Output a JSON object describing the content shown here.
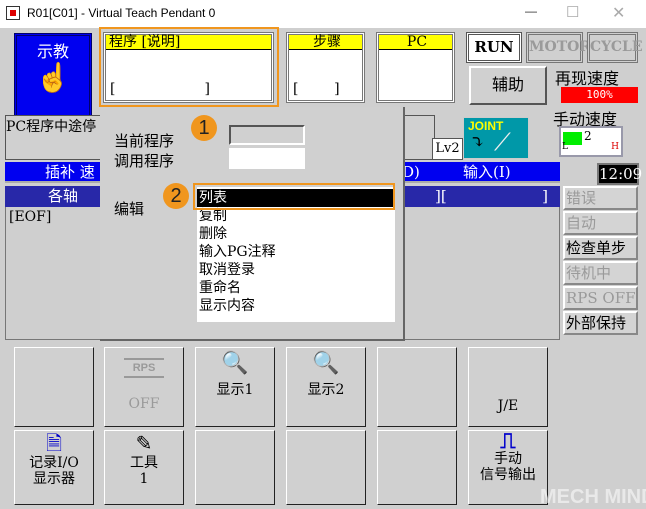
{
  "window": {
    "title": "R01[C01] - Virtual Teach Pendant 0"
  },
  "mode": {
    "label": "示教"
  },
  "program_box": {
    "header": "程序  [说明]",
    "value": "[                    ]"
  },
  "step_box": {
    "header": "步骤",
    "value": "[        ]"
  },
  "pc_box": {
    "header": "PC"
  },
  "status_buttons": {
    "run": "RUN",
    "motor": "MOTOR",
    "cycle": "CYCLE"
  },
  "aux_label": "辅助",
  "repeat_speed": {
    "label": "再现速度",
    "value": "100%"
  },
  "manual_speed": {
    "label": "手动速度",
    "value": "2",
    "low": "L",
    "high": "H",
    "fraction": 0.33
  },
  "pc_stop_text": "PC程序中途停",
  "level": "Lv2",
  "joint_label": "JOINT",
  "clock": "12:09",
  "bar1": {
    "left": "插补  速",
    "mid": "D)",
    "right": "输入(I)"
  },
  "bar2": {
    "left": "各轴",
    "right": "][                    ]"
  },
  "eof": "[EOF]",
  "side_buttons": [
    {
      "label": "错误",
      "enabled": false
    },
    {
      "label": "自动",
      "enabled": false
    },
    {
      "label": "检查单步",
      "enabled": true
    },
    {
      "label": "待机中",
      "enabled": false
    },
    {
      "label": "RPS OFF",
      "enabled": false
    },
    {
      "label": "外部保持",
      "enabled": true
    }
  ],
  "popup": {
    "current_program_label": "当前程序",
    "call_program_label": "调用程序",
    "edit_label": "编辑",
    "edit_items": [
      "列表",
      "复制",
      "删除",
      "输入PG注释",
      "取消登录",
      "重命名",
      "显示内容"
    ],
    "selected_index": 0
  },
  "annotations": {
    "badge1": "1",
    "badge2": "2",
    "highlight_color": "#f0961e"
  },
  "bottom_buttons": {
    "row1": [
      "",
      "RPS|OFF",
      "显示1",
      "显示2",
      "",
      "J/E"
    ],
    "row2": [
      "记录I/O\n显示器",
      "工具\n1",
      "",
      "",
      "",
      "手动\n信号输出"
    ]
  },
  "b": {
    "rps": "RPS",
    "off": "OFF",
    "disp1": "显示1",
    "disp2": "显示2",
    "je": "J/E",
    "rec1": "记录I/O",
    "rec2": "显示器",
    "tool1": "工具",
    "tool2": "1",
    "sig1": "手动",
    "sig2": "信号输出"
  },
  "watermark": "MECH MIND"
}
